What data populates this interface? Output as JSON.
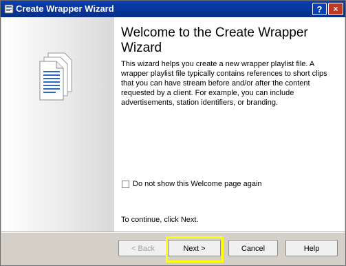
{
  "window": {
    "title": "Create Wrapper Wizard",
    "help_glyph": "?",
    "close_glyph": "×",
    "titlebar_color": "#0a3fb4",
    "close_color": "#c03820"
  },
  "main": {
    "heading": "Welcome to the Create Wrapper Wizard",
    "description": "This wizard helps you create a new wrapper playlist file. A wrapper playlist file typically contains references to short clips that you can have stream before and/or after the content requested by a client. For example, you can include advertisements, station identifiers, or branding.",
    "checkbox_label": "Do not show this Welcome page again",
    "checkbox_checked": false,
    "continue_text": "To continue, click Next."
  },
  "buttons": {
    "back": "< Back",
    "next": "Next >",
    "cancel": "Cancel",
    "help": "Help"
  },
  "highlight_color": "#ffff00",
  "icons": {
    "app": "wizard-app-icon",
    "sidebar": "document-stack-icon"
  }
}
